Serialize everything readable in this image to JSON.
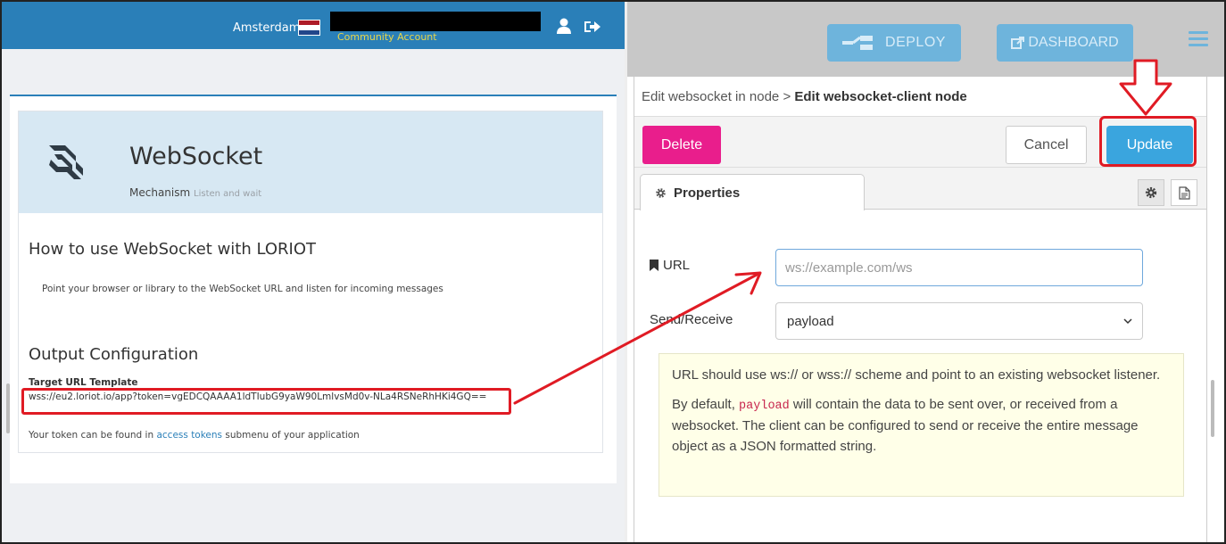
{
  "loriot": {
    "city": "Amsterdam",
    "account": "Community Account",
    "card": {
      "title": "WebSocket",
      "mechanism_label": "Mechanism",
      "mechanism_value": "Listen and wait"
    },
    "how_title": "How to use WebSocket with LORIOT",
    "how_text": "Point your browser or library to the WebSocket URL and listen for incoming messages",
    "output_title": "Output Configuration",
    "template_label": "Target URL Template",
    "template_url": "wss://eu2.loriot.io/app?token=vgEDCQAAAA1ldTIubG9yaW90LmlvsMd0v-NLa4RSNeRhHKi4GQ==",
    "token_prefix": "Your token can be found in ",
    "token_link": "access tokens",
    "token_suffix": " submenu of your application"
  },
  "nodered": {
    "deploy_label": "DEPLOY",
    "dashboard_label": "DASHBOARD",
    "breadcrumb_parent": "Edit websocket in node",
    "breadcrumb_sep": ">",
    "breadcrumb_current": "Edit websocket-client node",
    "delete_label": "Delete",
    "cancel_label": "Cancel",
    "update_label": "Update",
    "properties_tab": "Properties",
    "url_label": "URL",
    "url_placeholder": "ws://example.com/ws",
    "sendreceive_label": "Send/Receive",
    "sendreceive_value": "payload",
    "hint_line1": "URL should use ws:// or wss:// scheme and point to an existing websocket listener.",
    "hint_line2_pre": "By default, ",
    "hint_code": "payload",
    "hint_line2_post": " will contain the data to be sent over, or received from a websocket. The client can be configured to send or receive the entire message object as a JSON formatted string."
  },
  "colors": {
    "loriot_blue": "#2a7fb8",
    "nodered_button": "#6eb4dc",
    "delete_pink": "#e91e8c",
    "update_blue": "#3aa5de",
    "annotation_red": "#e01b24"
  },
  "icons": [
    "user-icon",
    "sign-out-icon",
    "websocket-logo-icon",
    "netherlands-flag-icon",
    "deploy-icon",
    "external-link-icon",
    "hamburger-icon",
    "gear-icon",
    "document-icon",
    "bookmark-icon",
    "chevron-down-icon"
  ]
}
